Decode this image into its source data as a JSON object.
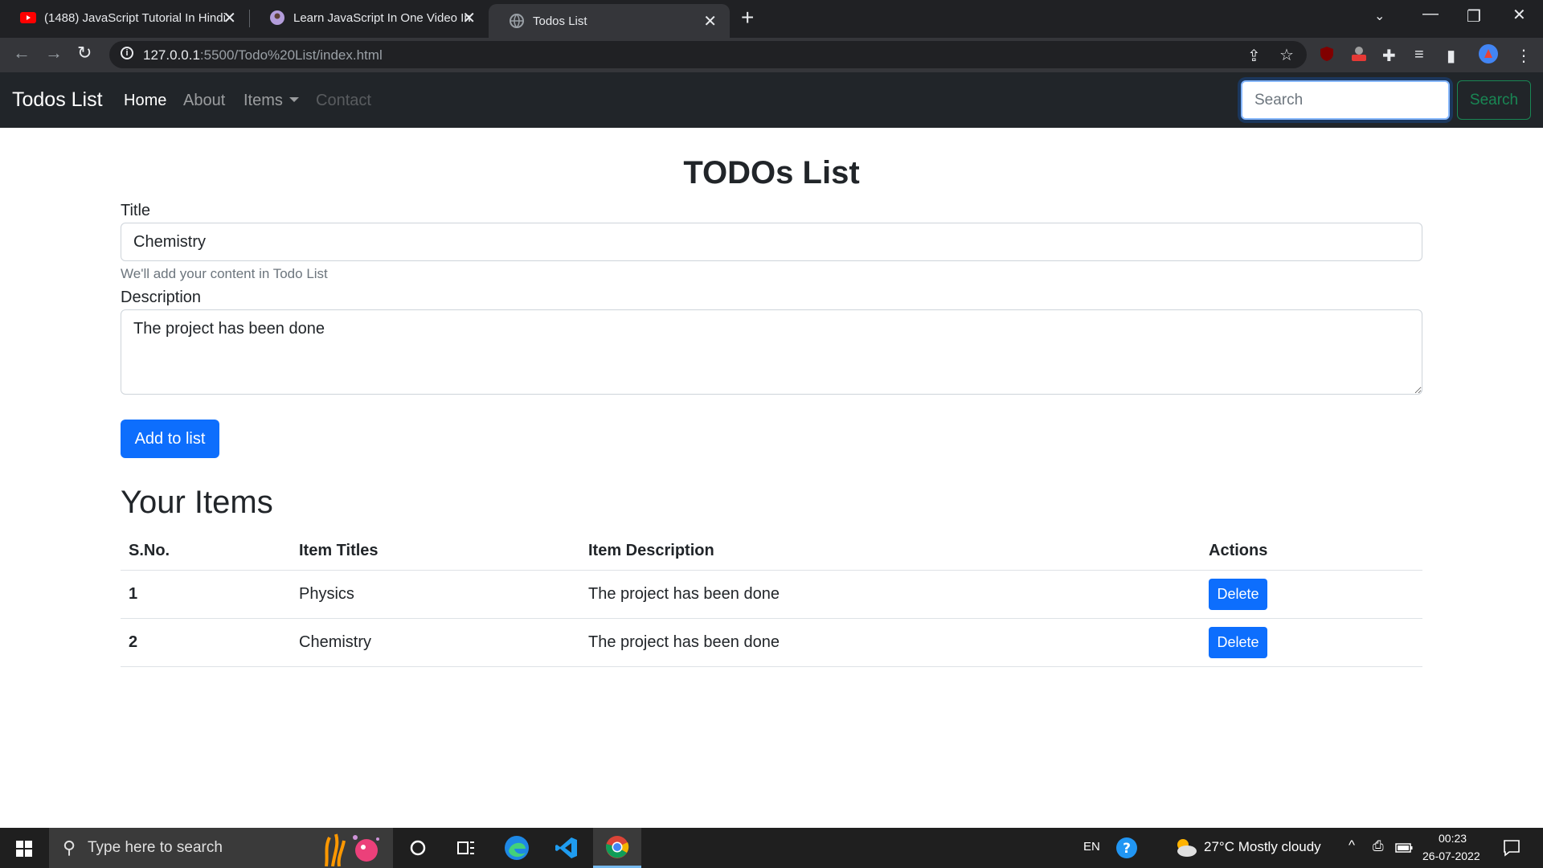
{
  "browser": {
    "tabs": [
      {
        "title": "(1488) JavaScript Tutorial In Hindi",
        "favicon": "youtube-icon"
      },
      {
        "title": "Learn JavaScript In One Video In",
        "favicon": "avatar-icon"
      },
      {
        "title": "Todos List",
        "favicon": "globe-icon",
        "active": true
      }
    ],
    "url_host": "127.0.0.1",
    "url_rest": ":5500/Todo%20List/index.html"
  },
  "navbar": {
    "brand": "Todos List",
    "links": {
      "home": "Home",
      "about": "About",
      "items": "Items",
      "contact": "Contact"
    },
    "search_placeholder": "Search",
    "search_button": "Search"
  },
  "form": {
    "heading": "TODOs List",
    "title_label": "Title",
    "title_value": "Chemistry",
    "title_help": "We'll add your content in Todo List",
    "description_label": "Description",
    "description_value": "The project has been done",
    "submit_label": "Add to list"
  },
  "items": {
    "heading": "Your Items",
    "columns": {
      "sno": "S.No.",
      "title": "Item Titles",
      "description": "Item Description",
      "actions": "Actions"
    },
    "rows": [
      {
        "sno": "1",
        "title": "Physics",
        "description": "The project has been done",
        "action": "Delete"
      },
      {
        "sno": "2",
        "title": "Chemistry",
        "description": "The project has been done",
        "action": "Delete"
      }
    ]
  },
  "taskbar": {
    "search_placeholder": "Type here to search",
    "language": "EN",
    "weather": "27°C  Mostly cloudy",
    "time": "00:23",
    "date": "26-07-2022"
  },
  "colors": {
    "primary": "#0d6efd",
    "success": "#198754",
    "navbar_bg": "#212529"
  }
}
